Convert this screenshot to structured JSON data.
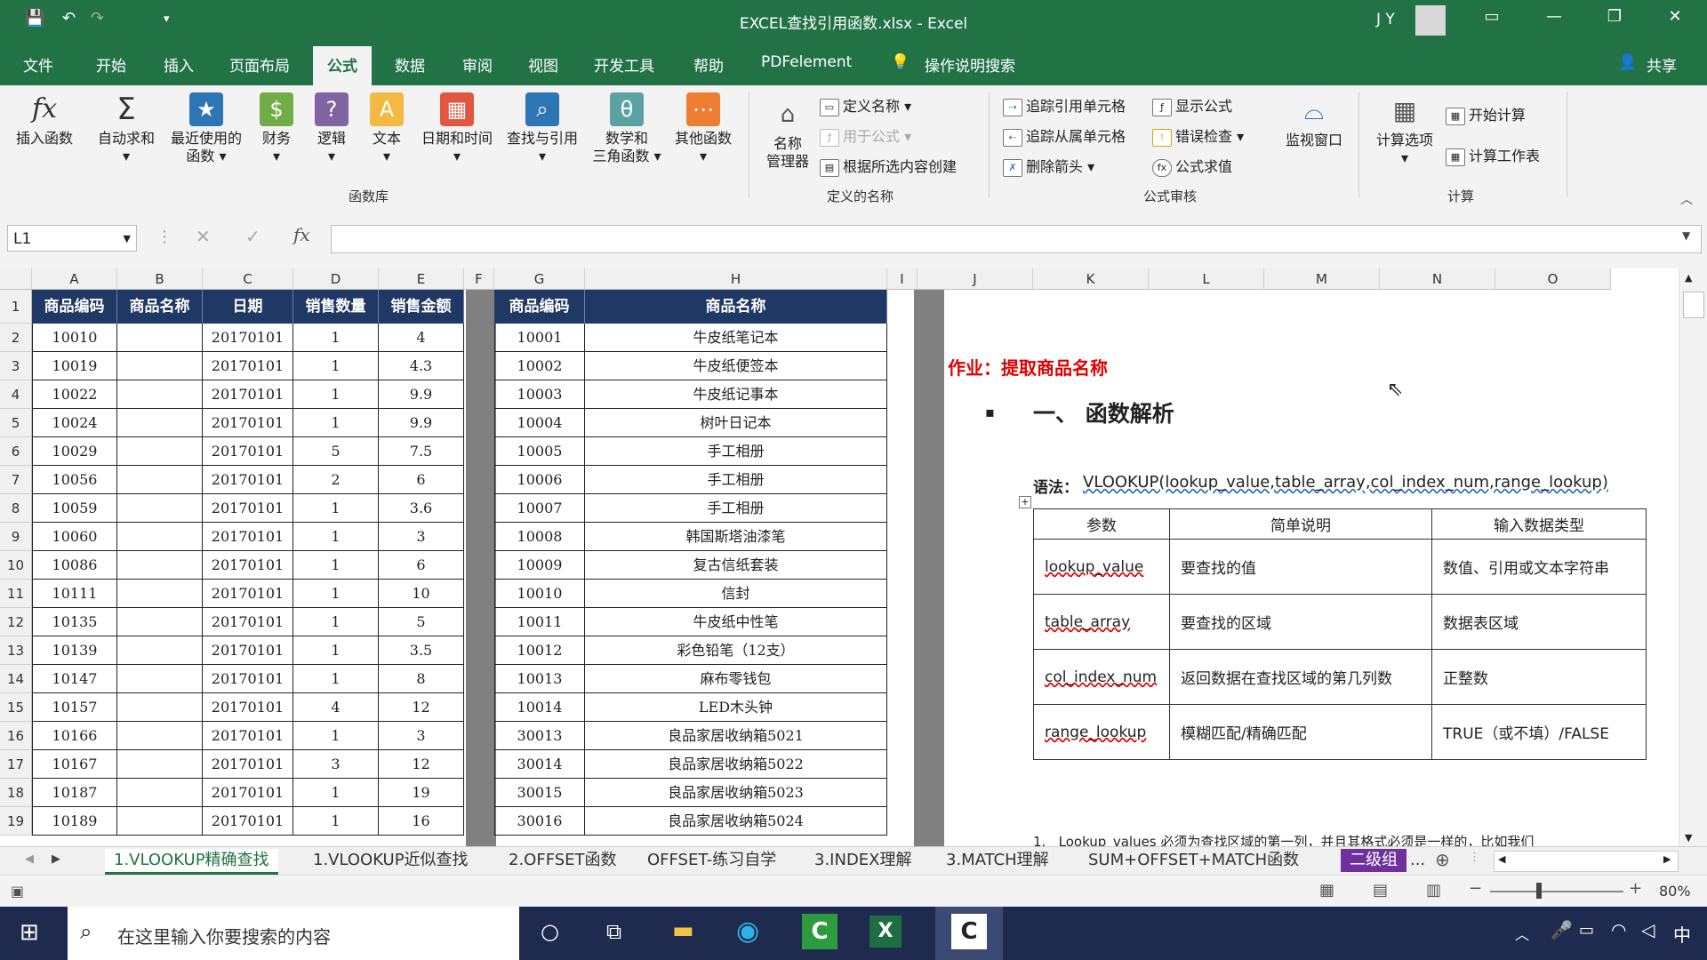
{
  "titlebar": {
    "title": "EXCEL查找引用函数.xlsx  -  Excel",
    "user": "J Y",
    "customize_symbol": "▾"
  },
  "menu": [
    "文件",
    "开始",
    "插入",
    "页面布局",
    "公式",
    "数据",
    "审阅",
    "视图",
    "开发工具",
    "帮助",
    "PDFelement"
  ],
  "menu_active_index": 4,
  "search_hint": "操作说明搜索",
  "share": "共享",
  "ribbon": {
    "insert_function": "插入函数",
    "autosum": "自动求和",
    "recent": [
      "最近使用的",
      "函数"
    ],
    "financial": "财务",
    "logical": "逻辑",
    "text": "文本",
    "datetime": "日期和时间",
    "lookup": "查找与引用",
    "math": [
      "数学和",
      "三角函数"
    ],
    "other": "其他函数",
    "group_library": "函数库",
    "name_manager": [
      "名称",
      "管理器"
    ],
    "define_name": "定义名称",
    "use_in_formula": "用于公式",
    "create_from_selection": "根据所选内容创建",
    "group_names": "定义的名称",
    "trace_precedents": "追踪引用单元格",
    "trace_dependents": "追踪从属单元格",
    "remove_arrows": "删除箭头",
    "show_formulas": "显示公式",
    "error_checking": "错误检查",
    "evaluate": "公式求值",
    "watch_window": "监视窗口",
    "group_audit": "公式审核",
    "calc_options": "计算选项",
    "calc_now": "开始计算",
    "calc_sheet": "计算工作表",
    "group_calc": "计算"
  },
  "formula_bar": {
    "name_box": "L1",
    "value": ""
  },
  "columns": [
    "A",
    "B",
    "C",
    "D",
    "E",
    "F",
    "G",
    "H",
    "I",
    "J",
    "K",
    "L",
    "M",
    "N",
    "O"
  ],
  "rows": [
    "1",
    "2",
    "3",
    "4",
    "5",
    "6",
    "7",
    "8",
    "9",
    "10",
    "11",
    "12",
    "13",
    "14",
    "15",
    "16",
    "17",
    "18",
    "19"
  ],
  "left_table": {
    "headers": [
      "商品编码",
      "商品名称",
      "日期",
      "销售数量",
      "销售金额"
    ],
    "rows": [
      [
        "10010",
        "",
        "20170101",
        "1",
        "4"
      ],
      [
        "10019",
        "",
        "20170101",
        "1",
        "4.3"
      ],
      [
        "10022",
        "",
        "20170101",
        "1",
        "9.9"
      ],
      [
        "10024",
        "",
        "20170101",
        "1",
        "9.9"
      ],
      [
        "10029",
        "",
        "20170101",
        "5",
        "7.5"
      ],
      [
        "10056",
        "",
        "20170101",
        "2",
        "6"
      ],
      [
        "10059",
        "",
        "20170101",
        "1",
        "3.6"
      ],
      [
        "10060",
        "",
        "20170101",
        "1",
        "3"
      ],
      [
        "10086",
        "",
        "20170101",
        "1",
        "6"
      ],
      [
        "10111",
        "",
        "20170101",
        "1",
        "10"
      ],
      [
        "10135",
        "",
        "20170101",
        "1",
        "5"
      ],
      [
        "10139",
        "",
        "20170101",
        "1",
        "3.5"
      ],
      [
        "10147",
        "",
        "20170101",
        "1",
        "8"
      ],
      [
        "10157",
        "",
        "20170101",
        "4",
        "12"
      ],
      [
        "10166",
        "",
        "20170101",
        "1",
        "3"
      ],
      [
        "10167",
        "",
        "20170101",
        "3",
        "12"
      ],
      [
        "10187",
        "",
        "20170101",
        "1",
        "19"
      ],
      [
        "10189",
        "",
        "20170101",
        "1",
        "16"
      ]
    ]
  },
  "right_table": {
    "headers": [
      "商品编码",
      "商品名称"
    ],
    "rows": [
      [
        "10001",
        "牛皮纸笔记本"
      ],
      [
        "10002",
        "牛皮纸便签本"
      ],
      [
        "10003",
        "牛皮纸记事本"
      ],
      [
        "10004",
        "树叶日记本"
      ],
      [
        "10005",
        "手工相册"
      ],
      [
        "10006",
        "手工相册"
      ],
      [
        "10007",
        "手工相册"
      ],
      [
        "10008",
        "韩国斯塔油漆笔"
      ],
      [
        "10009",
        "复古信纸套装"
      ],
      [
        "10010",
        "信封"
      ],
      [
        "10011",
        "牛皮纸中性笔"
      ],
      [
        "10012",
        "彩色铅笔（12支）"
      ],
      [
        "10013",
        "麻布零钱包"
      ],
      [
        "10014",
        "LED木头钟"
      ],
      [
        "30013",
        "良品家居收纳箱5021"
      ],
      [
        "30014",
        "良品家居收纳箱5022"
      ],
      [
        "30015",
        "良品家居收纳箱5023"
      ],
      [
        "30016",
        "良品家居收纳箱5024"
      ]
    ]
  },
  "doc": {
    "homework": "作业：提取商品名称",
    "section": "一、  函数解析",
    "syntax_label": "语法：",
    "syntax": "VLOOKUP(lookup_value,table_array,col_index_num,range_lookup)",
    "param_headers": [
      "参数",
      "简单说明",
      "输入数据类型"
    ],
    "params": [
      [
        "lookup_value",
        "要查找的值",
        "数值、引用或文本字符串"
      ],
      [
        "table_array",
        "要查找的区域",
        "数据表区域"
      ],
      [
        "col_index_num",
        "返回数据在查找区域的第几列数",
        "正整数"
      ],
      [
        "range_lookup",
        "模糊匹配/精确匹配",
        "TRUE（或不填）/FALSE"
      ]
    ],
    "note_num": "1.",
    "note_key": "Lookup_values",
    "note_text": "必须为查找区域的第一列，并且其格式必须是一样的，比如我们"
  },
  "tabs": [
    "1.VLOOKUP精确查找",
    "1.VLOOKUP近似查找",
    "2.OFFSET函数",
    "OFFSET-练习自学",
    "3.INDEX理解",
    "3.MATCH理解",
    "SUM+OFFSET+MATCH函数",
    "二级组"
  ],
  "tab_active_index": 0,
  "tab_more": "...",
  "zoom": "80%",
  "taskbar": {
    "search_placeholder": "在这里输入你要搜索的内容",
    "ime": "中"
  },
  "colors": {
    "excel_green": "#217346",
    "header_navy": "#1f3864",
    "homework_red": "#e00000",
    "taskbar": "#1e2b4f"
  }
}
